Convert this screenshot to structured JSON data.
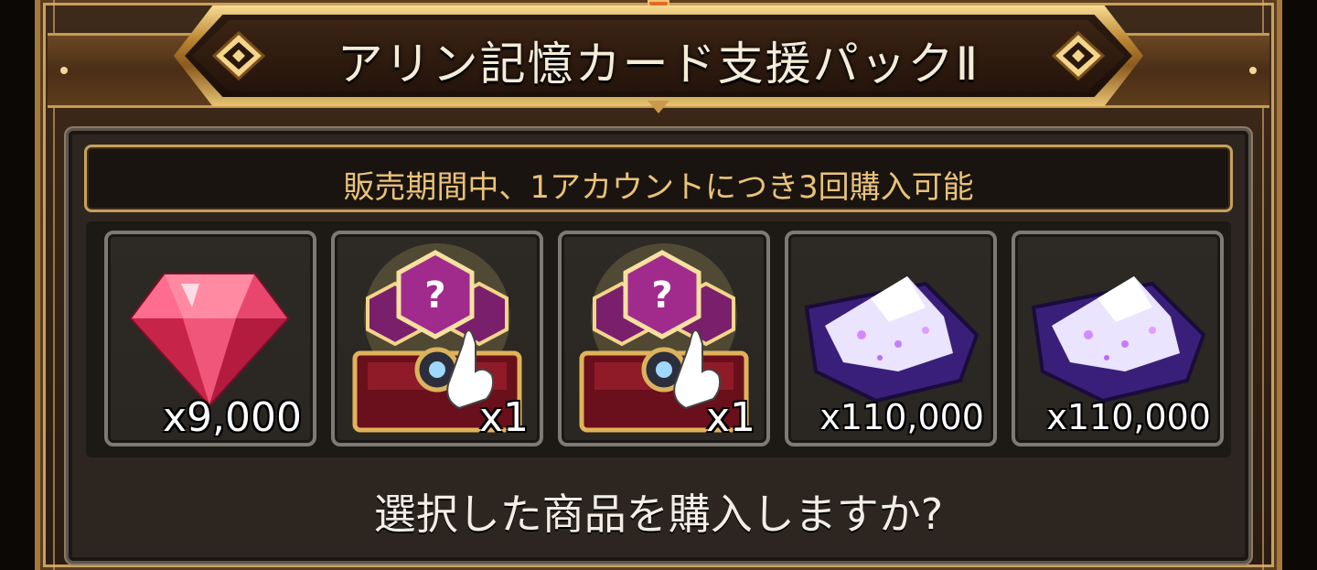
{
  "dialog": {
    "title": "アリン記憶カード支援パックⅡ",
    "notice": "販売期間中、1アカウントにつき3回購入可能",
    "prompt": "選択した商品を購入しますか?"
  },
  "items": [
    {
      "icon": "red-diamond-icon",
      "quantity": "x9,000"
    },
    {
      "icon": "memory-card-box-icon",
      "quantity": "x1"
    },
    {
      "icon": "memory-card-box-icon",
      "quantity": "x1"
    },
    {
      "icon": "crystal-powder-icon",
      "quantity": "x110,000"
    },
    {
      "icon": "crystal-powder-icon",
      "quantity": "x110,000"
    }
  ],
  "colors": {
    "frame_gold": "#c79a4e",
    "notice_text": "#e9c27a",
    "panel_bg": "#2d2620"
  }
}
